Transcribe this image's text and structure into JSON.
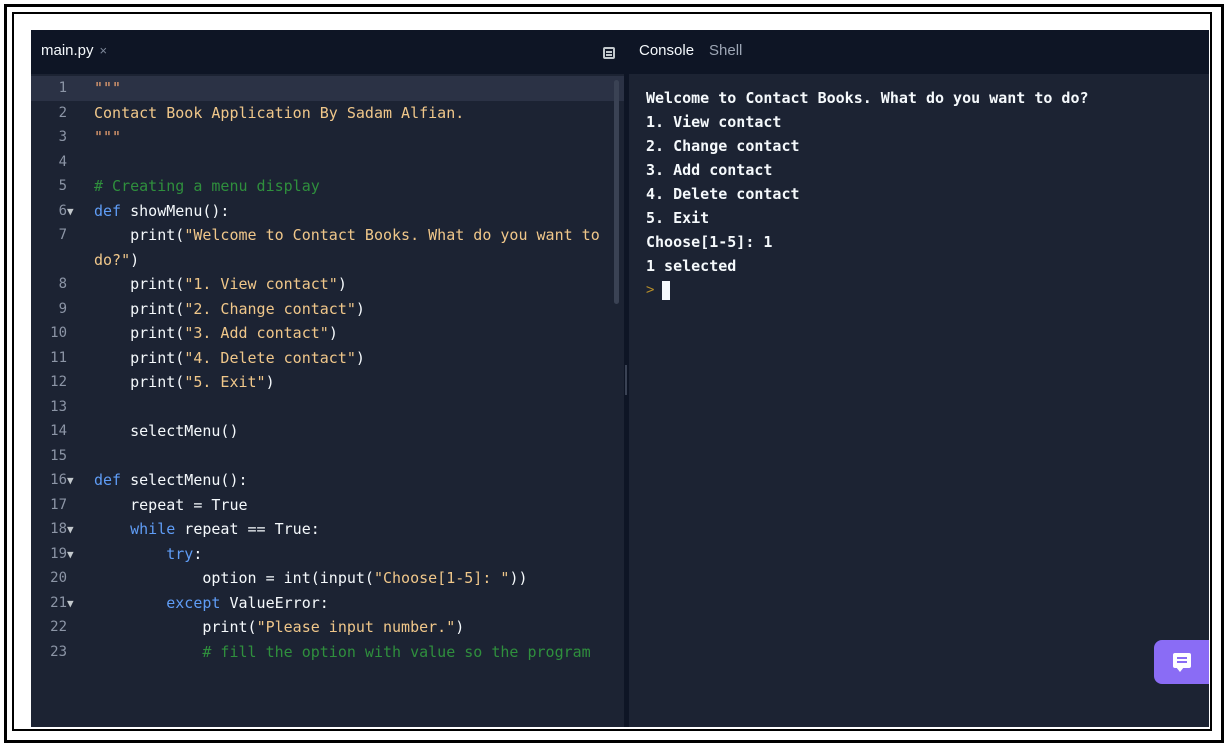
{
  "editor": {
    "tab_label": "main.py",
    "tab_close": "×",
    "lines": [
      {
        "num": "1",
        "fold": false,
        "parts": [
          {
            "t": "\"\"\"",
            "c": "tq"
          }
        ]
      },
      {
        "num": "2",
        "fold": false,
        "parts": [
          {
            "t": "Contact Book Application By Sadam Alfian.",
            "c": "str"
          }
        ]
      },
      {
        "num": "3",
        "fold": false,
        "parts": [
          {
            "t": "\"\"\"",
            "c": "tq"
          }
        ]
      },
      {
        "num": "4",
        "fold": false,
        "parts": []
      },
      {
        "num": "5",
        "fold": false,
        "parts": [
          {
            "t": "# Creating a menu display",
            "c": "cm"
          }
        ]
      },
      {
        "num": "6",
        "fold": true,
        "parts": [
          {
            "t": "def",
            "c": "kw"
          },
          {
            "t": " showMenu():",
            "c": ""
          }
        ]
      },
      {
        "num": "7",
        "fold": false,
        "wrap": true,
        "parts": [
          {
            "t": "    print(",
            "c": ""
          },
          {
            "t": "\"Welcome to Contact Books. What do you want to do?\"",
            "c": "str"
          },
          {
            "t": ")",
            "c": ""
          }
        ]
      },
      {
        "num": "8",
        "fold": false,
        "parts": [
          {
            "t": "    print(",
            "c": ""
          },
          {
            "t": "\"1. View contact\"",
            "c": "str"
          },
          {
            "t": ")",
            "c": ""
          }
        ]
      },
      {
        "num": "9",
        "fold": false,
        "parts": [
          {
            "t": "    print(",
            "c": ""
          },
          {
            "t": "\"2. Change contact\"",
            "c": "str"
          },
          {
            "t": ")",
            "c": ""
          }
        ]
      },
      {
        "num": "10",
        "fold": false,
        "parts": [
          {
            "t": "    print(",
            "c": ""
          },
          {
            "t": "\"3. Add contact\"",
            "c": "str"
          },
          {
            "t": ")",
            "c": ""
          }
        ]
      },
      {
        "num": "11",
        "fold": false,
        "parts": [
          {
            "t": "    print(",
            "c": ""
          },
          {
            "t": "\"4. Delete contact\"",
            "c": "str"
          },
          {
            "t": ")",
            "c": ""
          }
        ]
      },
      {
        "num": "12",
        "fold": false,
        "parts": [
          {
            "t": "    print(",
            "c": ""
          },
          {
            "t": "\"5. Exit\"",
            "c": "str"
          },
          {
            "t": ")",
            "c": ""
          }
        ]
      },
      {
        "num": "13",
        "fold": false,
        "parts": []
      },
      {
        "num": "14",
        "fold": false,
        "parts": [
          {
            "t": "    selectMenu()",
            "c": ""
          }
        ]
      },
      {
        "num": "15",
        "fold": false,
        "parts": []
      },
      {
        "num": "16",
        "fold": true,
        "parts": [
          {
            "t": "def",
            "c": "kw"
          },
          {
            "t": " selectMenu():",
            "c": ""
          }
        ]
      },
      {
        "num": "17",
        "fold": false,
        "parts": [
          {
            "t": "    repeat = True",
            "c": ""
          }
        ]
      },
      {
        "num": "18",
        "fold": true,
        "parts": [
          {
            "t": "    ",
            "c": ""
          },
          {
            "t": "while",
            "c": "kw"
          },
          {
            "t": " repeat == True:",
            "c": ""
          }
        ]
      },
      {
        "num": "19",
        "fold": true,
        "parts": [
          {
            "t": "        ",
            "c": ""
          },
          {
            "t": "try",
            "c": "kw"
          },
          {
            "t": ":",
            "c": ""
          }
        ]
      },
      {
        "num": "20",
        "fold": false,
        "parts": [
          {
            "t": "            option = int(input(",
            "c": ""
          },
          {
            "t": "\"Choose[1-5]: \"",
            "c": "str"
          },
          {
            "t": "))",
            "c": ""
          }
        ]
      },
      {
        "num": "21",
        "fold": true,
        "parts": [
          {
            "t": "        ",
            "c": ""
          },
          {
            "t": "except",
            "c": "kw"
          },
          {
            "t": " ValueError:",
            "c": ""
          }
        ]
      },
      {
        "num": "22",
        "fold": false,
        "parts": [
          {
            "t": "            print(",
            "c": ""
          },
          {
            "t": "\"Please input number.\"",
            "c": "str"
          },
          {
            "t": ")",
            "c": ""
          }
        ]
      },
      {
        "num": "23",
        "fold": false,
        "parts": [
          {
            "t": "            # fill the option with value so the program",
            "c": "cm"
          }
        ]
      }
    ]
  },
  "console": {
    "tabs": [
      "Console",
      "Shell"
    ],
    "output": [
      "Welcome to Contact Books. What do you want to do?",
      "1. View contact",
      "2. Change contact",
      "3. Add contact",
      "4. Delete contact",
      "5. Exit",
      "Choose[1-5]: 1",
      "1 selected"
    ],
    "prompt": ">"
  },
  "icons": {
    "panel": "panel-toggle-icon",
    "chat": "chat-icon",
    "fold": "fold-arrow-icon"
  },
  "colors": {
    "background": "#1c2333",
    "tabbar": "#0e1525",
    "keyword": "#5f9cf5",
    "string": "#f0c78a",
    "comment": "#2f8f3d",
    "chat_button": "#8a6cf5"
  }
}
